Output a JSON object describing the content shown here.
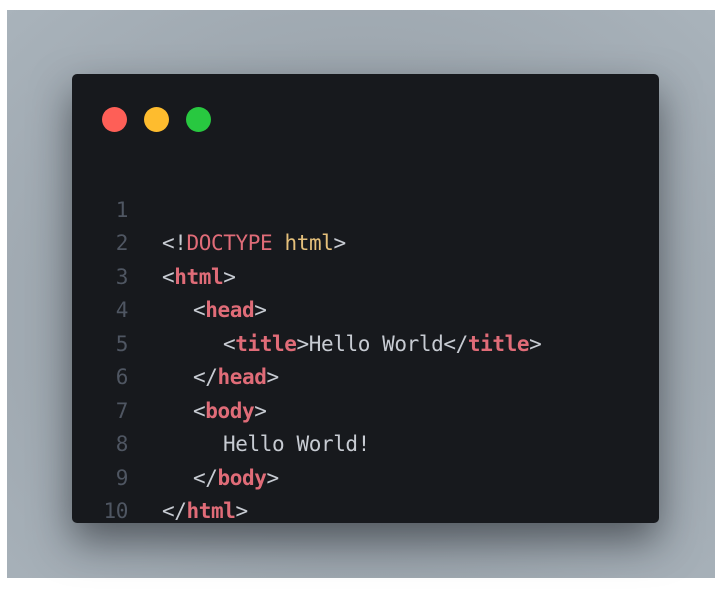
{
  "window": {
    "traffic_lights": [
      {
        "name": "close",
        "color": "#fe5f57"
      },
      {
        "name": "minimize",
        "color": "#febc2e"
      },
      {
        "name": "maximize",
        "color": "#28c840"
      }
    ]
  },
  "editor": {
    "colors": {
      "background": "#17191d",
      "line_number": "#4f5662",
      "punctuation": "#c7cbd2",
      "tag": "#e06c78",
      "keyword": "#e5c07b"
    },
    "lines": [
      {
        "number": "1",
        "tokens": {
          "open": "<!",
          "doctype": "DOCTYPE",
          "space": " ",
          "kw": "html",
          "close": ">"
        }
      },
      {
        "number": "2",
        "tokens": {
          "open": "<",
          "tag": "html",
          "close": ">"
        }
      },
      {
        "number": "3",
        "tokens": {
          "open": "<",
          "tag": "head",
          "close": ">"
        }
      },
      {
        "number": "4",
        "tokens": {
          "open": "<",
          "tag": "title",
          "close": ">",
          "text": "Hello World",
          "open2": "</",
          "tag2": "title",
          "close2": ">"
        }
      },
      {
        "number": "5",
        "tokens": {
          "open": "</",
          "tag": "head",
          "close": ">"
        }
      },
      {
        "number": "6",
        "tokens": {
          "open": "<",
          "tag": "body",
          "close": ">"
        }
      },
      {
        "number": "7",
        "tokens": {
          "text": "Hello World!"
        }
      },
      {
        "number": "8",
        "tokens": {
          "open": "</",
          "tag": "body",
          "close": ">"
        }
      },
      {
        "number": "9",
        "tokens": {
          "open": "</",
          "tag": "html",
          "close": ">"
        }
      },
      {
        "number": "10",
        "tokens": {}
      }
    ]
  }
}
